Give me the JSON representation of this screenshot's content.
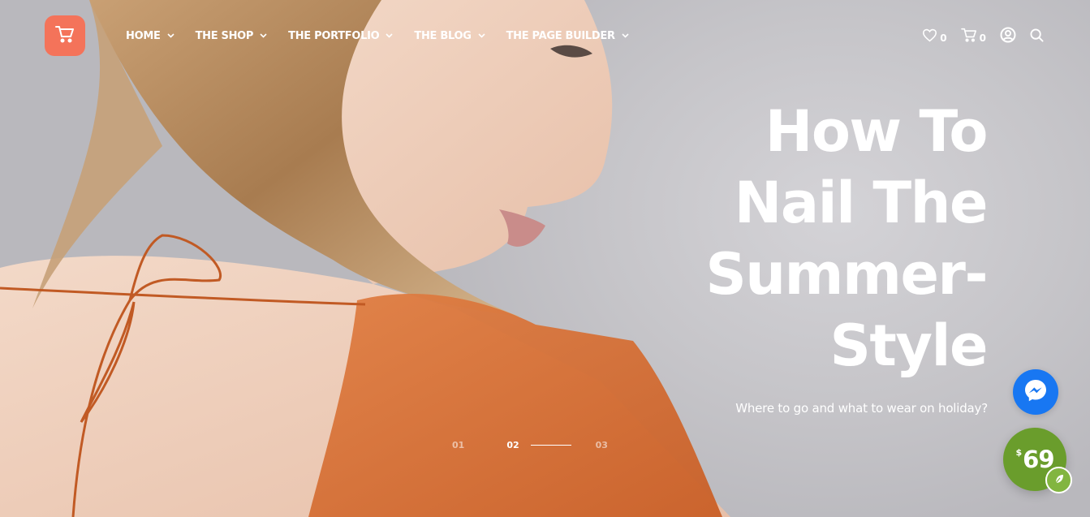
{
  "nav": {
    "items": [
      {
        "label": "HOME"
      },
      {
        "label": "THE SHOP"
      },
      {
        "label": "THE PORTFOLIO"
      },
      {
        "label": "THE BLOG"
      },
      {
        "label": "THE PAGE BUILDER"
      }
    ]
  },
  "header_tools": {
    "wishlist_count": "0",
    "cart_count": "0"
  },
  "hero": {
    "headline_lines": [
      "How To",
      "Nail The",
      "Summer-",
      "Style"
    ],
    "subtitle": "Where to go and what to wear on holiday?"
  },
  "pager": {
    "items": [
      "01",
      "02",
      "03"
    ],
    "active": "02"
  },
  "price_badge": {
    "currency": "$",
    "amount": "69"
  },
  "colors": {
    "logo_bg": "#f4735a",
    "messenger_bg": "#1877f2",
    "price_bg": "#6a9d2c",
    "dress": "#d9733a"
  },
  "icons": {
    "logo": "cart-icon",
    "wishlist": "heart-icon",
    "cart": "cart-icon",
    "account": "user-icon",
    "search": "search-icon",
    "messenger": "messenger-icon",
    "leaf": "leaf-icon"
  }
}
